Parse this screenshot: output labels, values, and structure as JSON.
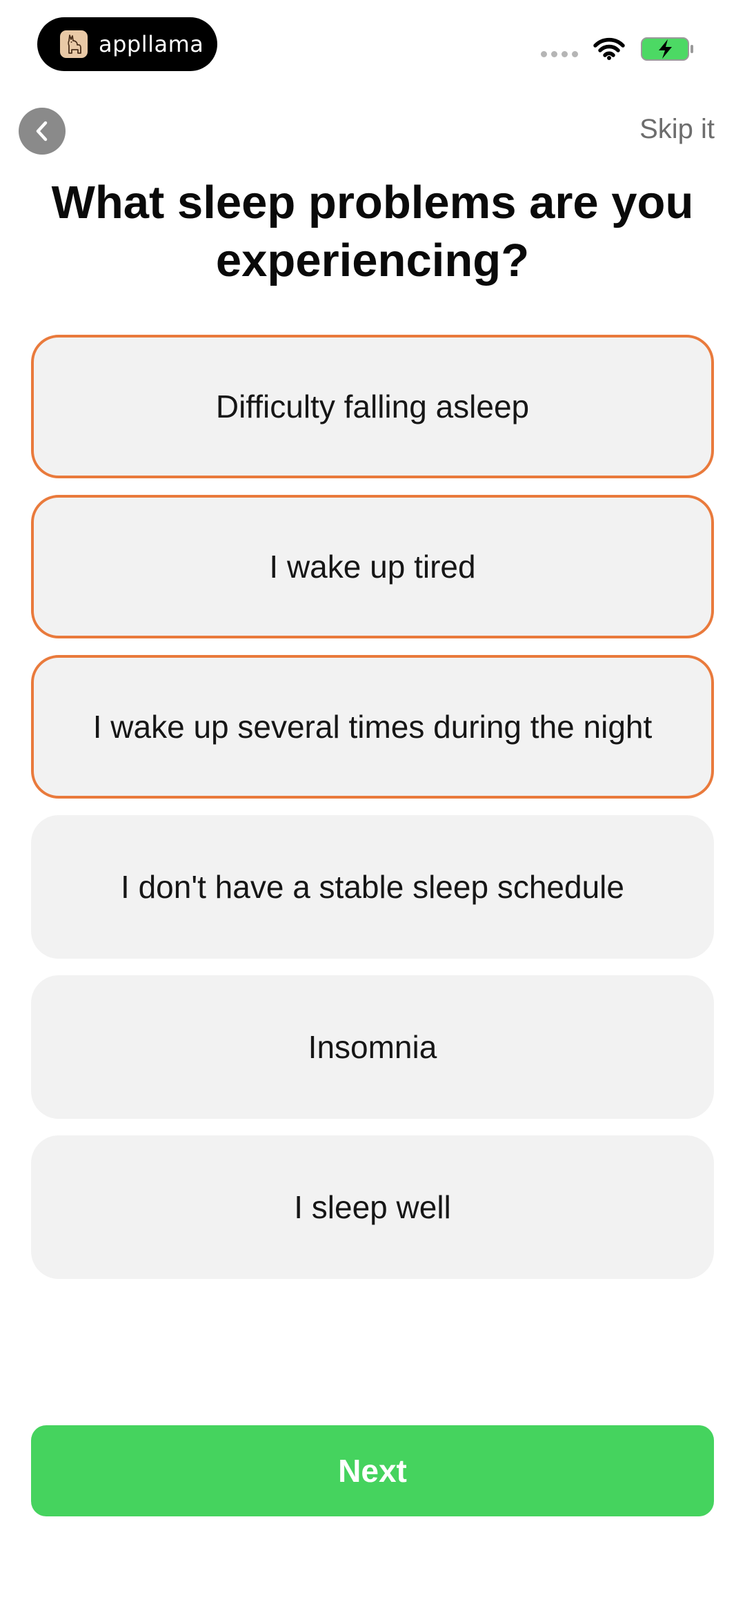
{
  "status_bar": {
    "brand_name": "appllama",
    "logo_icon": "llama-icon",
    "signal_icon": "cellular-signal-icon",
    "wifi_icon": "wifi-icon",
    "battery_icon": "battery-charging-icon",
    "battery_color": "#4cd964"
  },
  "nav": {
    "back_icon": "chevron-left-icon",
    "skip_label": "Skip it"
  },
  "title": "What sleep problems are you experiencing?",
  "options": [
    {
      "label": "Difficulty falling asleep",
      "selected": true
    },
    {
      "label": "I wake up tired",
      "selected": true
    },
    {
      "label": "I wake up several times during the night",
      "selected": true
    },
    {
      "label": "I don't have a stable sleep schedule",
      "selected": false
    },
    {
      "label": "Insomnia",
      "selected": false
    },
    {
      "label": "I sleep well",
      "selected": false
    }
  ],
  "next_label": "Next",
  "colors": {
    "selected_border": "#e97a3c",
    "option_background": "#f2f2f2",
    "next_button": "#45d35e",
    "back_button": "#8a8a8a"
  }
}
